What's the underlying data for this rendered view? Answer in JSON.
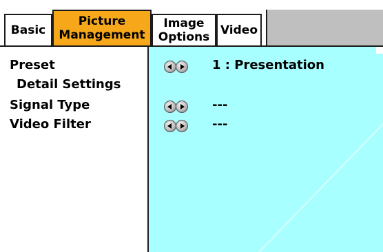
{
  "tabs": [
    {
      "line1": "Basic",
      "line2": "",
      "active": false
    },
    {
      "line1": "Picture",
      "line2": "Management",
      "active": true
    },
    {
      "line1": "Image",
      "line2": "Options",
      "active": false
    },
    {
      "line1": "Video",
      "line2": "",
      "active": false
    }
  ],
  "items": [
    {
      "label": "Preset",
      "value": "1 : Presentation",
      "has_arrows": true
    },
    {
      "label": "Detail Settings",
      "value": "",
      "has_arrows": false
    },
    {
      "label": "Signal Type",
      "value": "---",
      "has_arrows": true
    },
    {
      "label": "Video Filter",
      "value": "---",
      "has_arrows": true
    }
  ],
  "colors": {
    "active_tab": "#f7a81a",
    "value_panel": "#a8ffff",
    "tab_strip_background": "#bfbfbf"
  },
  "icons": {
    "arrows": "left-right-adjust-arrows-icon"
  }
}
